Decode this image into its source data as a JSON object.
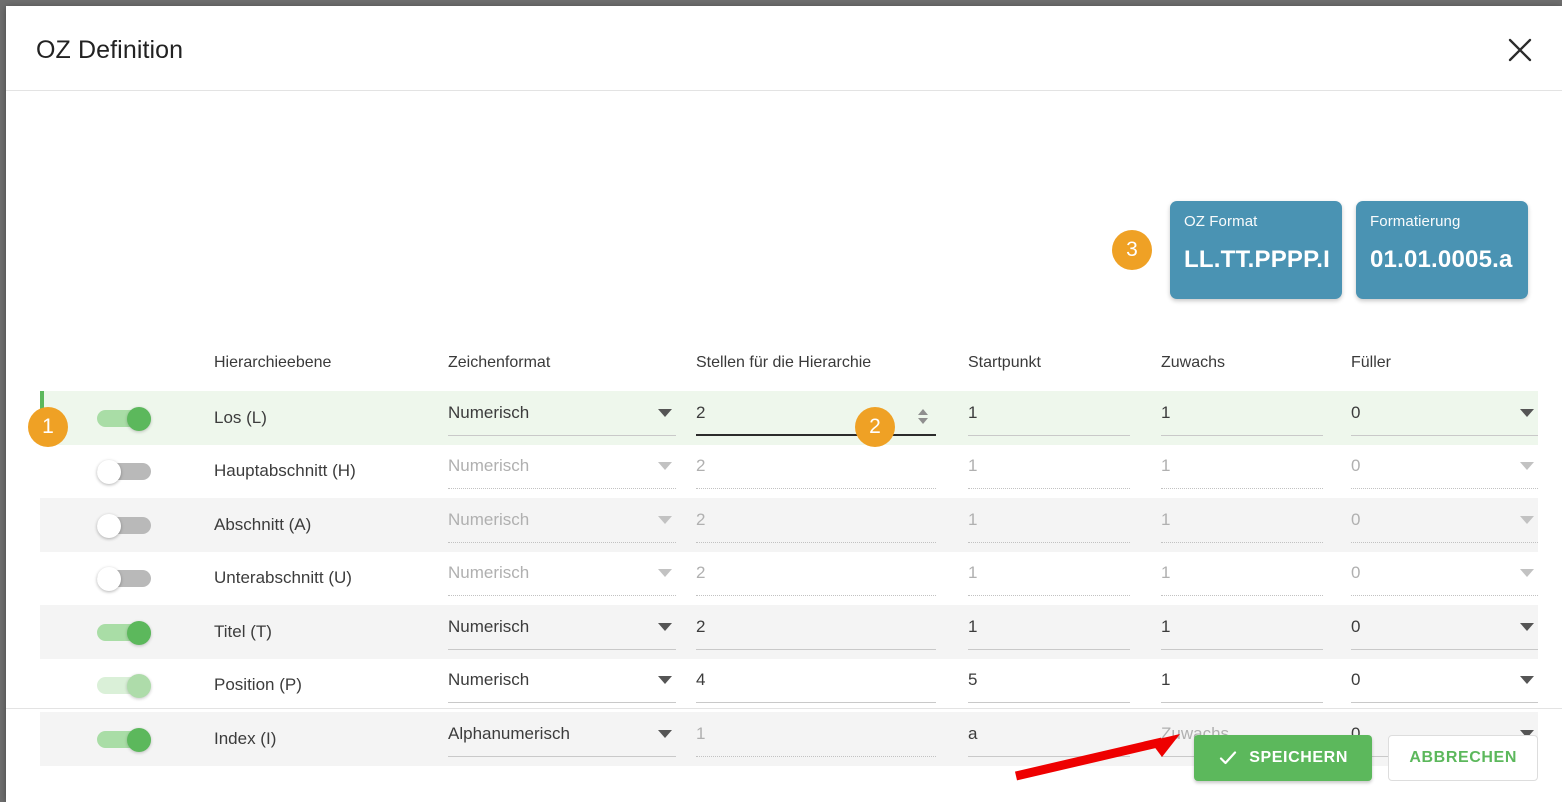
{
  "dialog": {
    "title": "OZ Definition",
    "close_icon": "close-icon"
  },
  "badges": {
    "step1": "1",
    "step2": "2",
    "step3": "3",
    "accent_color": "#efa125"
  },
  "info_cards": [
    {
      "label": "OZ Format",
      "value": "LL.TT.PPPP.I",
      "color": "#4a93b3"
    },
    {
      "label": "Formatierung",
      "value": "01.01.0005.a",
      "color": "#4a93b3"
    }
  ],
  "table": {
    "headers": {
      "level": "Hierarchieebene",
      "format": "Zeichenformat",
      "digits": "Stellen für die Hierarchie",
      "start": "Startpunkt",
      "increment": "Zuwachs",
      "filler": "Füller"
    },
    "rows": [
      {
        "level": "Los (L)",
        "format": "Numerisch",
        "digits": "2",
        "start": "1",
        "increment": "1",
        "filler": "0"
      },
      {
        "level": "Hauptabschnitt (H)",
        "format": "Numerisch",
        "digits": "2",
        "start": "1",
        "increment": "1",
        "filler": "0"
      },
      {
        "level": "Abschnitt (A)",
        "format": "Numerisch",
        "digits": "2",
        "start": "1",
        "increment": "1",
        "filler": "0"
      },
      {
        "level": "Unterabschnitt (U)",
        "format": "Numerisch",
        "digits": "2",
        "start": "1",
        "increment": "1",
        "filler": "0"
      },
      {
        "level": "Titel (T)",
        "format": "Numerisch",
        "digits": "2",
        "start": "1",
        "increment": "1",
        "filler": "0"
      },
      {
        "level": "Position (P)",
        "format": "Numerisch",
        "digits": "4",
        "start": "5",
        "increment": "1",
        "filler": "0"
      },
      {
        "level": "Index (I)",
        "format": "Alphanumerisch",
        "digits": "1",
        "start": "a",
        "increment": "Zuwachs",
        "filler": "0"
      }
    ]
  },
  "footer": {
    "save_label": "SPEICHERN",
    "save_icon": "check-icon",
    "cancel_label": "ABBRECHEN",
    "save_color": "#5cb85c"
  },
  "annotation": {
    "arrow_color": "#ee0000"
  }
}
